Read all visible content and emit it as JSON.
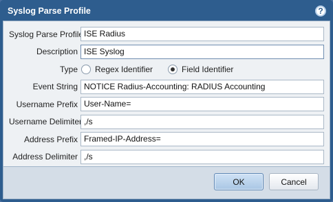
{
  "dialog": {
    "title": "Syslog Parse Profile",
    "help_icon": "help-icon"
  },
  "fields": {
    "profile_label": "Syslog Parse Profile",
    "profile_value": "ISE Radius",
    "description_label": "Description",
    "description_value": "ISE Syslog",
    "type_label": "Type",
    "type_options": [
      "Regex Identifier",
      "Field Identifier"
    ],
    "type_selected": "Field Identifier",
    "event_string_label": "Event String",
    "event_string_value": "NOTICE Radius-Accounting: RADIUS Accounting",
    "username_prefix_label": "Username Prefix",
    "username_prefix_value": "User-Name=",
    "username_delimiter_label": "Username Delimiter",
    "username_delimiter_value": ",/s",
    "address_prefix_label": "Address Prefix",
    "address_prefix_value": "Framed-IP-Address=",
    "address_delimiter_label": "Address Delimiter",
    "address_delimiter_value": ",/s"
  },
  "buttons": {
    "ok_label": "OK",
    "cancel_label": "Cancel"
  },
  "colors": {
    "titlebar": "#2e5d8e",
    "panel": "#eef1f4",
    "footer": "#d4dde7"
  }
}
